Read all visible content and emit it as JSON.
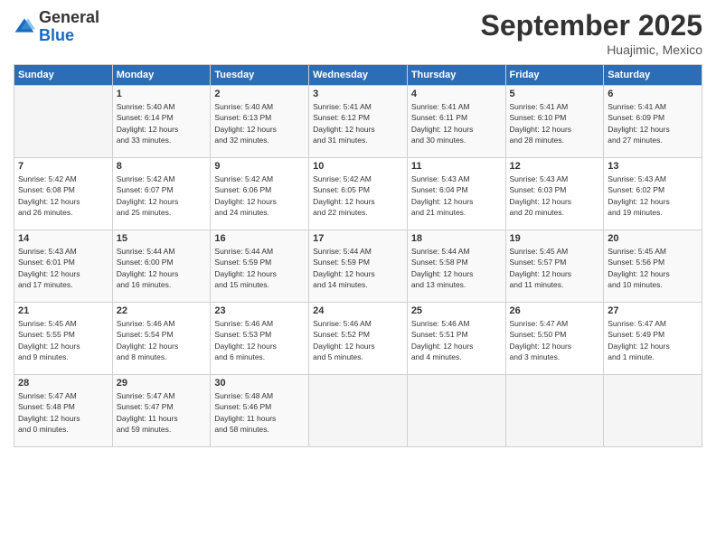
{
  "logo": {
    "general": "General",
    "blue": "Blue"
  },
  "title": "September 2025",
  "subtitle": "Huajimic, Mexico",
  "headers": [
    "Sunday",
    "Monday",
    "Tuesday",
    "Wednesday",
    "Thursday",
    "Friday",
    "Saturday"
  ],
  "weeks": [
    [
      {
        "day": "",
        "info": ""
      },
      {
        "day": "1",
        "info": "Sunrise: 5:40 AM\nSunset: 6:14 PM\nDaylight: 12 hours\nand 33 minutes."
      },
      {
        "day": "2",
        "info": "Sunrise: 5:40 AM\nSunset: 6:13 PM\nDaylight: 12 hours\nand 32 minutes."
      },
      {
        "day": "3",
        "info": "Sunrise: 5:41 AM\nSunset: 6:12 PM\nDaylight: 12 hours\nand 31 minutes."
      },
      {
        "day": "4",
        "info": "Sunrise: 5:41 AM\nSunset: 6:11 PM\nDaylight: 12 hours\nand 30 minutes."
      },
      {
        "day": "5",
        "info": "Sunrise: 5:41 AM\nSunset: 6:10 PM\nDaylight: 12 hours\nand 28 minutes."
      },
      {
        "day": "6",
        "info": "Sunrise: 5:41 AM\nSunset: 6:09 PM\nDaylight: 12 hours\nand 27 minutes."
      }
    ],
    [
      {
        "day": "7",
        "info": "Sunrise: 5:42 AM\nSunset: 6:08 PM\nDaylight: 12 hours\nand 26 minutes."
      },
      {
        "day": "8",
        "info": "Sunrise: 5:42 AM\nSunset: 6:07 PM\nDaylight: 12 hours\nand 25 minutes."
      },
      {
        "day": "9",
        "info": "Sunrise: 5:42 AM\nSunset: 6:06 PM\nDaylight: 12 hours\nand 24 minutes."
      },
      {
        "day": "10",
        "info": "Sunrise: 5:42 AM\nSunset: 6:05 PM\nDaylight: 12 hours\nand 22 minutes."
      },
      {
        "day": "11",
        "info": "Sunrise: 5:43 AM\nSunset: 6:04 PM\nDaylight: 12 hours\nand 21 minutes."
      },
      {
        "day": "12",
        "info": "Sunrise: 5:43 AM\nSunset: 6:03 PM\nDaylight: 12 hours\nand 20 minutes."
      },
      {
        "day": "13",
        "info": "Sunrise: 5:43 AM\nSunset: 6:02 PM\nDaylight: 12 hours\nand 19 minutes."
      }
    ],
    [
      {
        "day": "14",
        "info": "Sunrise: 5:43 AM\nSunset: 6:01 PM\nDaylight: 12 hours\nand 17 minutes."
      },
      {
        "day": "15",
        "info": "Sunrise: 5:44 AM\nSunset: 6:00 PM\nDaylight: 12 hours\nand 16 minutes."
      },
      {
        "day": "16",
        "info": "Sunrise: 5:44 AM\nSunset: 5:59 PM\nDaylight: 12 hours\nand 15 minutes."
      },
      {
        "day": "17",
        "info": "Sunrise: 5:44 AM\nSunset: 5:59 PM\nDaylight: 12 hours\nand 14 minutes."
      },
      {
        "day": "18",
        "info": "Sunrise: 5:44 AM\nSunset: 5:58 PM\nDaylight: 12 hours\nand 13 minutes."
      },
      {
        "day": "19",
        "info": "Sunrise: 5:45 AM\nSunset: 5:57 PM\nDaylight: 12 hours\nand 11 minutes."
      },
      {
        "day": "20",
        "info": "Sunrise: 5:45 AM\nSunset: 5:56 PM\nDaylight: 12 hours\nand 10 minutes."
      }
    ],
    [
      {
        "day": "21",
        "info": "Sunrise: 5:45 AM\nSunset: 5:55 PM\nDaylight: 12 hours\nand 9 minutes."
      },
      {
        "day": "22",
        "info": "Sunrise: 5:46 AM\nSunset: 5:54 PM\nDaylight: 12 hours\nand 8 minutes."
      },
      {
        "day": "23",
        "info": "Sunrise: 5:46 AM\nSunset: 5:53 PM\nDaylight: 12 hours\nand 6 minutes."
      },
      {
        "day": "24",
        "info": "Sunrise: 5:46 AM\nSunset: 5:52 PM\nDaylight: 12 hours\nand 5 minutes."
      },
      {
        "day": "25",
        "info": "Sunrise: 5:46 AM\nSunset: 5:51 PM\nDaylight: 12 hours\nand 4 minutes."
      },
      {
        "day": "26",
        "info": "Sunrise: 5:47 AM\nSunset: 5:50 PM\nDaylight: 12 hours\nand 3 minutes."
      },
      {
        "day": "27",
        "info": "Sunrise: 5:47 AM\nSunset: 5:49 PM\nDaylight: 12 hours\nand 1 minute."
      }
    ],
    [
      {
        "day": "28",
        "info": "Sunrise: 5:47 AM\nSunset: 5:48 PM\nDaylight: 12 hours\nand 0 minutes."
      },
      {
        "day": "29",
        "info": "Sunrise: 5:47 AM\nSunset: 5:47 PM\nDaylight: 11 hours\nand 59 minutes."
      },
      {
        "day": "30",
        "info": "Sunrise: 5:48 AM\nSunset: 5:46 PM\nDaylight: 11 hours\nand 58 minutes."
      },
      {
        "day": "",
        "info": ""
      },
      {
        "day": "",
        "info": ""
      },
      {
        "day": "",
        "info": ""
      },
      {
        "day": "",
        "info": ""
      }
    ]
  ]
}
